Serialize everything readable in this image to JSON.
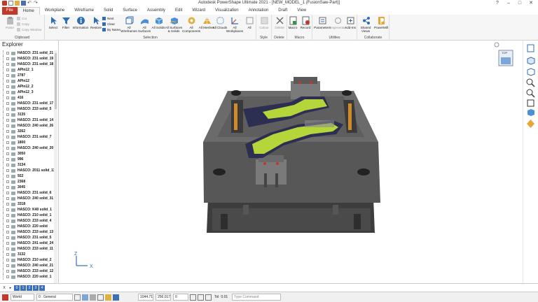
{
  "window": {
    "title": "Autodesk PowerShape Ultimate 2021 - [NEW_MODEL_1 (FusionSaw-Part)]"
  },
  "tabs": [
    "File",
    "Home",
    "Workplane",
    "Wireframe",
    "Solid",
    "Surface",
    "Assembly",
    "Edit",
    "Wizard",
    "Visualization",
    "Annotation",
    "Draft",
    "View"
  ],
  "ribbon": {
    "clipboard": {
      "label": "Clipboard",
      "paste": "Paste",
      "cut": "Cut",
      "copy": "Copy",
      "copy_window": "Copy Window"
    },
    "selection": {
      "label": "Selection",
      "select": "Select",
      "filter": "Filter",
      "information": "Information",
      "restore": "Restore",
      "next": "Next",
      "clear": "Clear",
      "by_name": "By Name",
      "all_wireframes": "All Wireframes",
      "all_surfaces": "All Surfaces",
      "all_solids": "All Solids",
      "all_surfaces_solids": "All Surfaces & Solids",
      "all_components": "All Components",
      "all_meshes": "All Meshes",
      "all_clouds": "All Clouds",
      "all_workplanes": "All Workplanes",
      "all": "All"
    },
    "style": {
      "label": "Style",
      "colour": "Colour"
    },
    "delete": {
      "label": "Delete",
      "delete": "Delete"
    },
    "macro": {
      "label": "Macro",
      "macro": "Macro",
      "record": "Record"
    },
    "utilities": {
      "label": "Utilities",
      "parameters": "Parameters",
      "regenerate": "Regenerate",
      "add_ins": "Add-Ins"
    },
    "collaborate": {
      "label": "Collaborate",
      "shared_views": "Shared Views",
      "powermill": "PowerMill"
    }
  },
  "explorer": {
    "title": "Explorer",
    "items": [
      "HASCO: Z31 solid_21",
      "HASCO: Z31 solid_19",
      "HASCO: Z31 solid_18",
      "APin12_1",
      "2787",
      "APin12",
      "APin12_2",
      "APin12_3",
      "416",
      "HASCO: Z31 solid_17",
      "HASCO: Z33 solid_5",
      "3135",
      "HASCO: Z31 solid_14",
      "HASCO: Z40 solid_26",
      "3262",
      "HASCO: Z31 solid_7",
      "1800",
      "HASCO: Z40 solid_20",
      "3050",
      "996",
      "3134",
      "HASCO: Z011 solid_11",
      "922",
      "2368",
      "3045",
      "HASCO: Z31 solid_6",
      "HASCO: Z40 solid_31",
      "3318",
      "HASCO: K40 solid_1",
      "HASCO: Z10 solid_1",
      "HASCO: Z33 solid_4",
      "HASCO: Z20 solid",
      "HASCO: Z33 solid_13",
      "HASCO: Z31 solid_5",
      "HASCO: Z41 solid_24",
      "HASCO: Z33 solid_11",
      "3132",
      "HASCO: Z10 solid_2",
      "HASCO: Z40 solid_21",
      "HASCO: Z33 solid_12",
      "HASCO: Z20 solid_1"
    ]
  },
  "viewport": {
    "view_cube_label": "TOP",
    "axis_z": "Z",
    "axis_x": "X"
  },
  "layers": {
    "close": "X",
    "items": [
      "0",
      "1",
      "2",
      "3",
      "4"
    ]
  },
  "statusbar": {
    "workplane": "World",
    "level": "0 : General",
    "coord_x": "1044.71",
    "coord_y": "256.017",
    "coord_z": "0",
    "tol_label": "Tol",
    "tol_value": "0.01",
    "command_placeholder": "Type Command"
  },
  "colors": {
    "file_tab": "#c0392b",
    "mold_plate": "#4a4a4a",
    "part_green": "#b5d63b",
    "part_dark": "#2c2f52",
    "slot_orange": "#d08a2a"
  }
}
